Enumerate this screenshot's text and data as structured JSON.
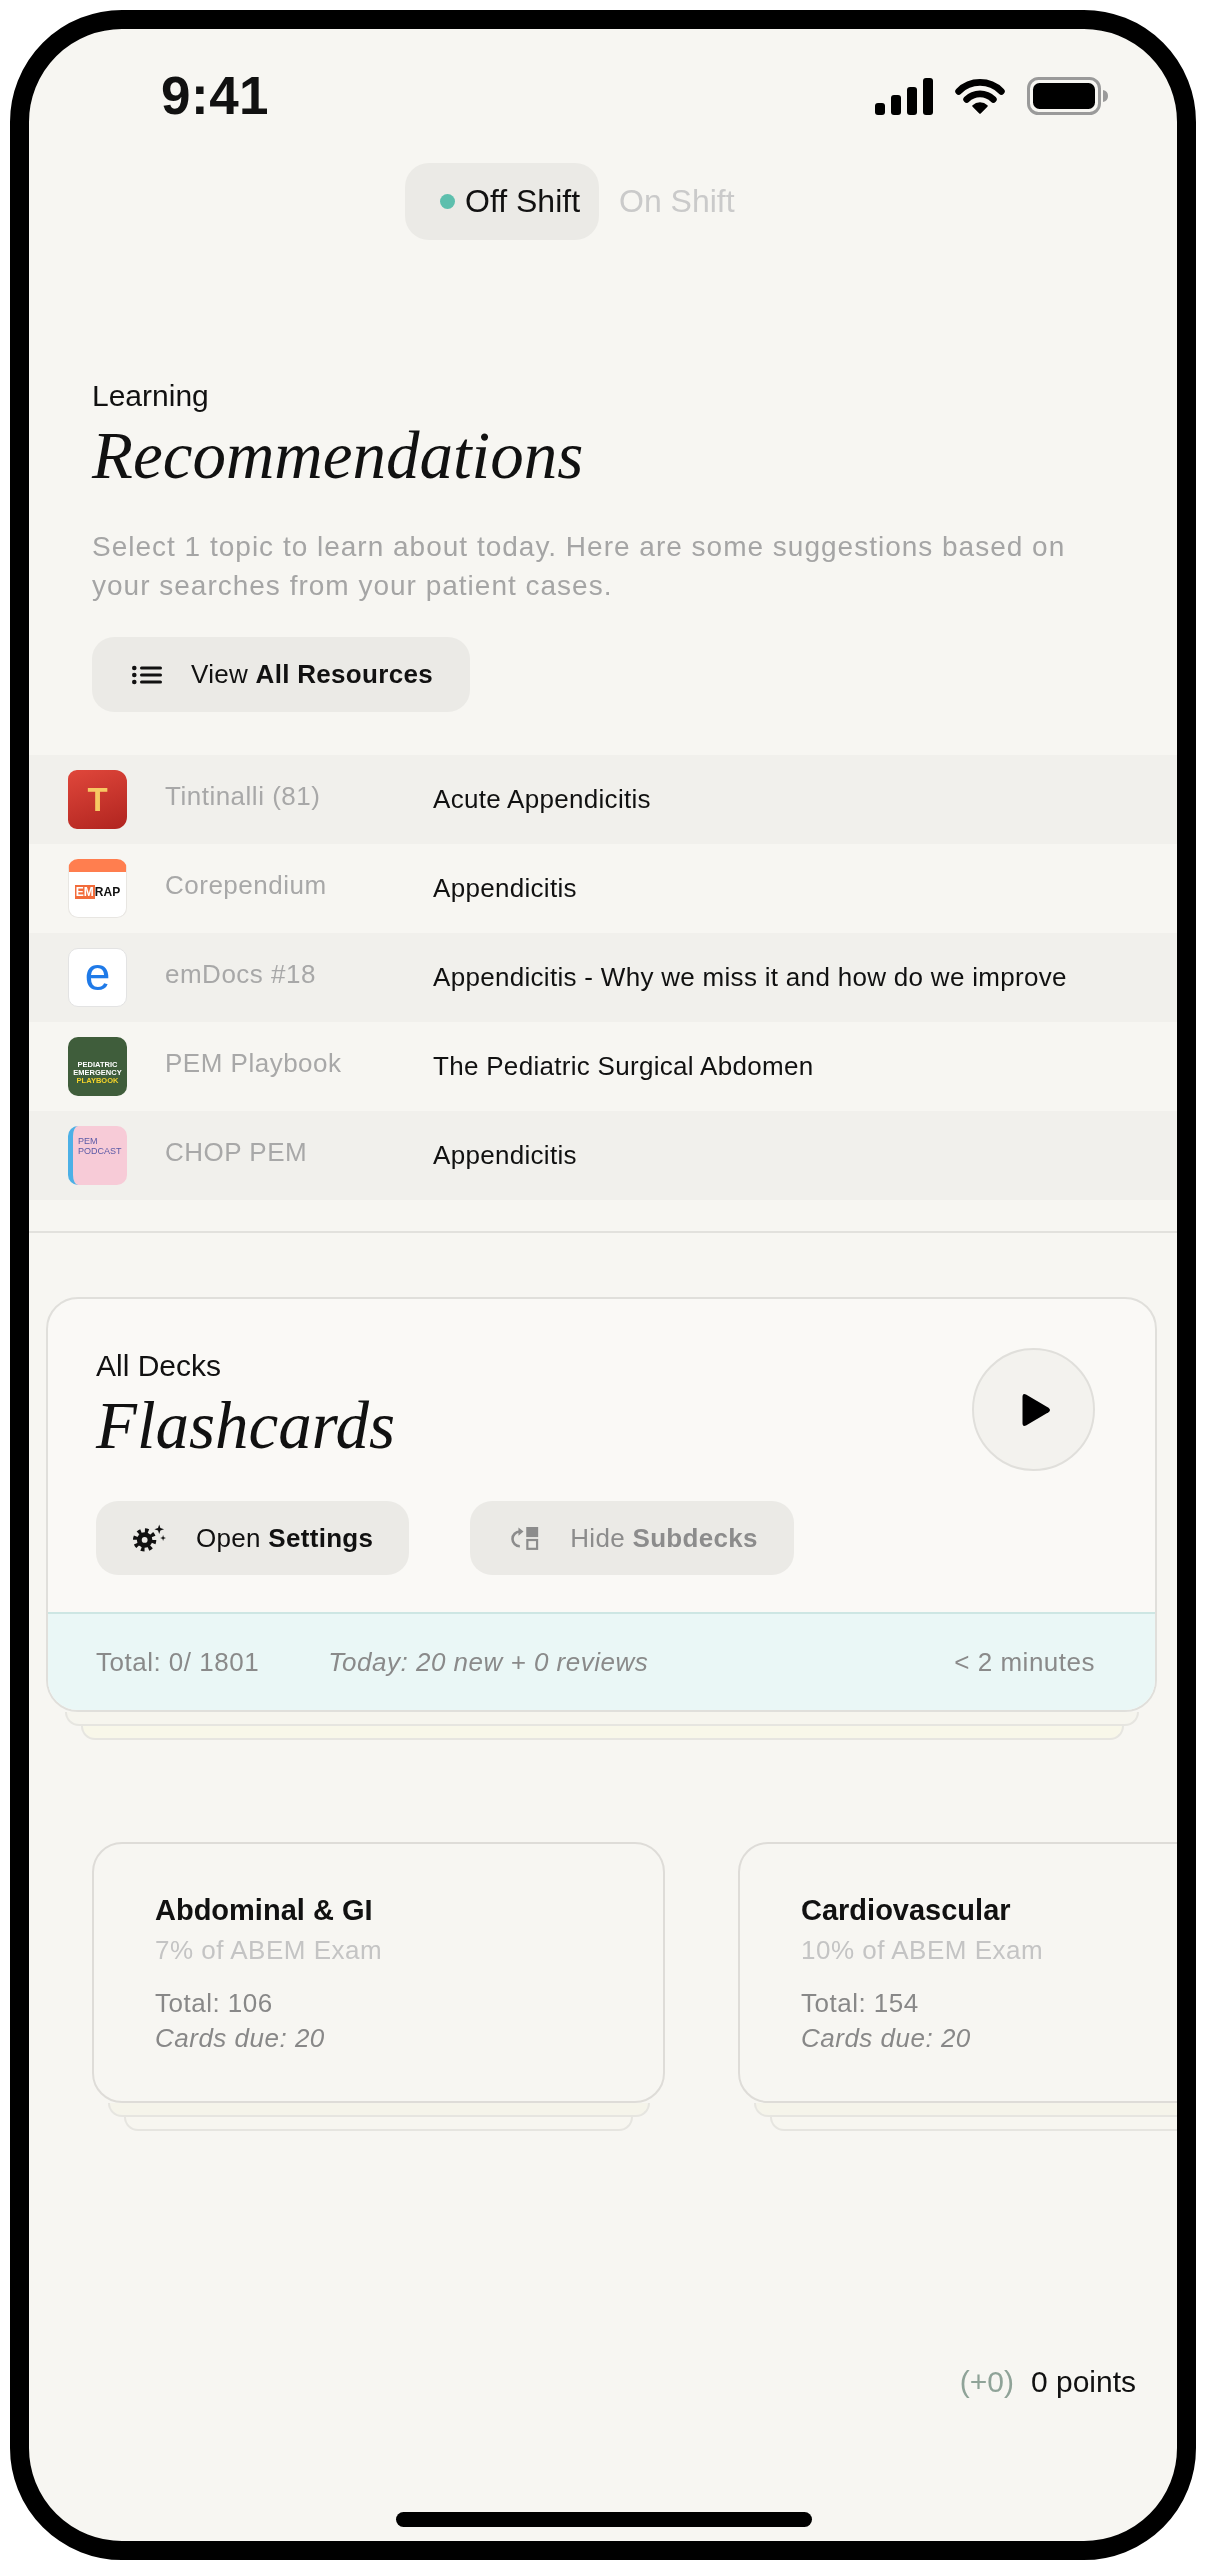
{
  "status_bar": {
    "time": "9:41"
  },
  "shift_toggle": [
    {
      "label": "Off Shift",
      "selected": true
    },
    {
      "label": "On Shift",
      "selected": false
    }
  ],
  "recommendations": {
    "eyebrow": "Learning",
    "title": "Recommendations",
    "description": "Select 1 topic to learn about today. Here are some suggestions based on your searches from your patient cases.",
    "button": "View **All Resources**"
  },
  "resources": [
    {
      "logo": {
        "kind": "tile-red",
        "text": [
          "T"
        ]
      },
      "source": "Tintinalli (81)",
      "topic": "Acute Appendicitis"
    },
    {
      "logo": {
        "kind": "banner",
        "text": [
          "EM",
          "RAP"
        ]
      },
      "source": "Corependium",
      "topic": "Appendicitis"
    },
    {
      "logo": {
        "kind": "letter-blue",
        "text": [
          "e"
        ]
      },
      "source": "emDocs #18",
      "topic": "Appendicitis - Why we miss it and how do we improve"
    },
    {
      "logo": {
        "kind": "cover-green",
        "text": [
          "PEDIATRIC",
          "EMERGENCY",
          "PLAYBOOK"
        ]
      },
      "source": "PEM Playbook",
      "topic": "The Pediatric Surgical Abdomen"
    },
    {
      "logo": {
        "kind": "cover-pink",
        "text": [
          "PEM",
          "PODCAST"
        ]
      },
      "source": "CHOP PEM",
      "topic": "Appendicitis"
    }
  ],
  "flashcards": {
    "eyebrow": "All Decks",
    "title": "Flashcards",
    "buttons": [
      {
        "kind": "settings",
        "label": "Open **Settings**",
        "disabled": false
      },
      {
        "kind": "subdecks",
        "label": "Hide **Subdecks**",
        "disabled": true
      }
    ],
    "stats": {
      "total": "Total: 0/ 1801",
      "today": "Today: 20 new + 0 reviews",
      "estimate": "< 2 minutes"
    }
  },
  "decks": [
    {
      "title": "Abdominal & GI",
      "share": "7% of ABEM Exam",
      "total": "Total: 106",
      "due": "Cards due: 20"
    },
    {
      "title": "Cardiovascular",
      "share": "10% of ABEM Exam",
      "total": "Total: 154",
      "due": "Cards due: 20"
    }
  ],
  "points": {
    "delta": "(+0)",
    "total": "0 points"
  }
}
